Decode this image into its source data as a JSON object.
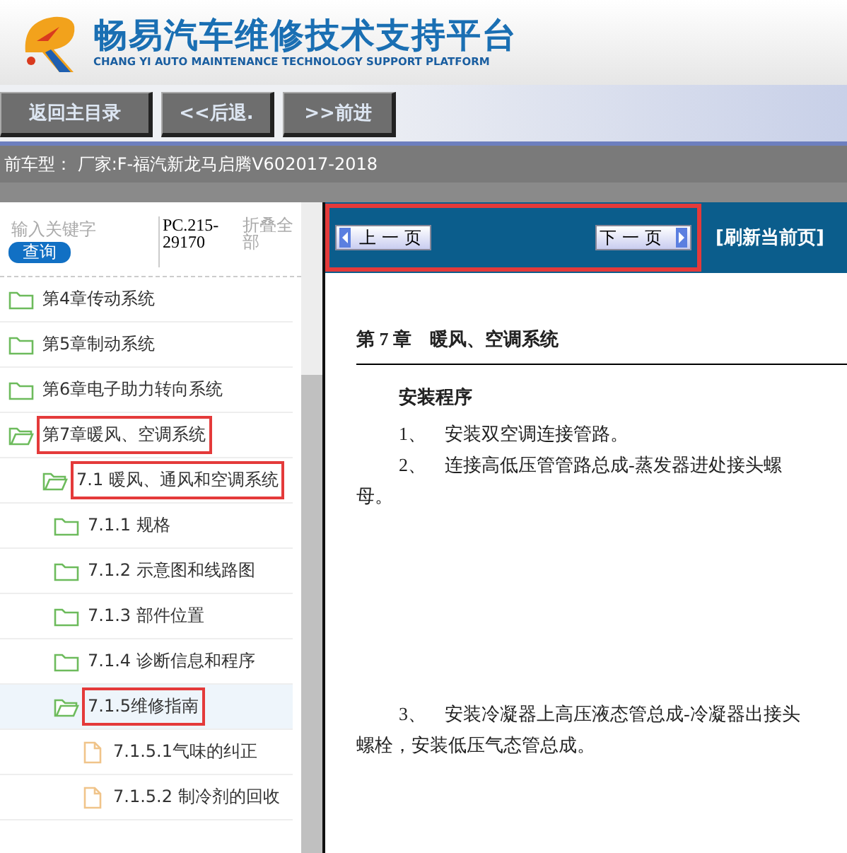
{
  "header": {
    "title": "畅易汽车维修技术支持平台",
    "subtitle": "CHANG YI AUTO MAINTENANCE TECHNOLOGY SUPPORT PLATFORM"
  },
  "nav_buttons": [
    "返回主目录",
    "<<后退.",
    ">>前进"
  ],
  "vehicle_bar": "前车型： 厂家:F-福汽新龙马启腾V602017-2018",
  "sidebar": {
    "search": {
      "placeholder": "输入关键字"
    },
    "search_button": "查询",
    "model_code": "PC.215-29170",
    "collapse_all": "折叠全部",
    "tree": [
      {
        "label": "第4章传动系统",
        "kind": "folder",
        "expanded": false,
        "selected": false,
        "annotated": false
      },
      {
        "label": "第5章制动系统",
        "kind": "folder",
        "expanded": false,
        "selected": false,
        "annotated": false
      },
      {
        "label": "第6章电子助力转向系统",
        "kind": "folder",
        "expanded": false,
        "selected": false,
        "annotated": false
      },
      {
        "label": "第7章暖风、空调系统",
        "kind": "folder",
        "expanded": true,
        "selected": false,
        "annotated": true,
        "children": [
          {
            "label": "7.1 暖风、通风和空调系统",
            "kind": "folder",
            "expanded": true,
            "selected": false,
            "annotated": true,
            "children": [
              {
                "label": "7.1.1 规格",
                "kind": "folder",
                "expanded": false,
                "selected": false,
                "annotated": false
              },
              {
                "label": "7.1.2 示意图和线路图",
                "kind": "folder",
                "expanded": false,
                "selected": false,
                "annotated": false
              },
              {
                "label": "7.1.3 部件位置",
                "kind": "folder",
                "expanded": false,
                "selected": false,
                "annotated": false
              },
              {
                "label": "7.1.4 诊断信息和程序",
                "kind": "folder",
                "expanded": false,
                "selected": false,
                "annotated": false
              },
              {
                "label": "7.1.5维修指南",
                "kind": "folder",
                "expanded": true,
                "selected": true,
                "annotated": true,
                "children": [
                  {
                    "label": "7.1.5.1气味的纠正",
                    "kind": "file",
                    "selected": false,
                    "annotated": false
                  },
                  {
                    "label": "7.1.5.2 制冷剂的回收",
                    "kind": "file",
                    "selected": false,
                    "annotated": false
                  }
                ]
              }
            ]
          }
        ]
      }
    ]
  },
  "pager": {
    "annotated": true,
    "prev": "上一页",
    "next": "下一页",
    "refresh": "[刷新当前页]"
  },
  "document": {
    "chapter_title": "第 7 章　暖风、空调系统",
    "section_title": "安装程序",
    "paragraphs": [
      "1、　安装双空调连接管路。",
      "2、　连接高低压管管路总成-蒸发器进处接头螺母。",
      "3、　安装冷凝器上高压液态管总成-冷凝器出接头螺栓，安装低压气态管总成。"
    ]
  }
}
